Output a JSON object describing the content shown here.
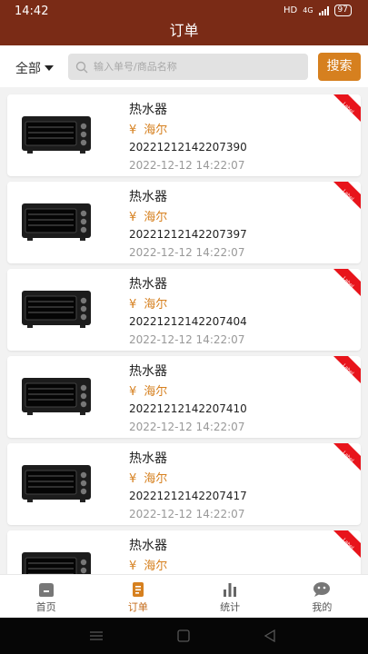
{
  "status": {
    "time": "14:42",
    "hd": "HD",
    "network": "4G",
    "battery": "97"
  },
  "header": {
    "title": "订单"
  },
  "search": {
    "filter_label": "全部",
    "placeholder": "输入单号/商品名称",
    "button_label": "搜索"
  },
  "orders": [
    {
      "name": "热水器",
      "currency": "¥",
      "brand": "海尔",
      "order_no": "20221212142207390",
      "time": "2022-12-12 14:22:07",
      "badge": "Label"
    },
    {
      "name": "热水器",
      "currency": "¥",
      "brand": "海尔",
      "order_no": "20221212142207397",
      "time": "2022-12-12 14:22:07",
      "badge": "Label"
    },
    {
      "name": "热水器",
      "currency": "¥",
      "brand": "海尔",
      "order_no": "20221212142207404",
      "time": "2022-12-12 14:22:07",
      "badge": "Label"
    },
    {
      "name": "热水器",
      "currency": "¥",
      "brand": "海尔",
      "order_no": "20221212142207410",
      "time": "2022-12-12 14:22:07",
      "badge": "Label"
    },
    {
      "name": "热水器",
      "currency": "¥",
      "brand": "海尔",
      "order_no": "20221212142207417",
      "time": "2022-12-12 14:22:07",
      "badge": "Label"
    },
    {
      "name": "热水器",
      "currency": "¥",
      "brand": "海尔",
      "badge": "Label"
    }
  ],
  "tabs": [
    {
      "label": "首页",
      "icon": "home-icon"
    },
    {
      "label": "订单",
      "icon": "order-icon",
      "active": true
    },
    {
      "label": "统计",
      "icon": "stats-icon"
    },
    {
      "label": "我的",
      "icon": "profile-icon"
    }
  ],
  "colors": {
    "header_bg": "#7a2b16",
    "accent": "#d6801f",
    "badge": "#e8141b"
  }
}
